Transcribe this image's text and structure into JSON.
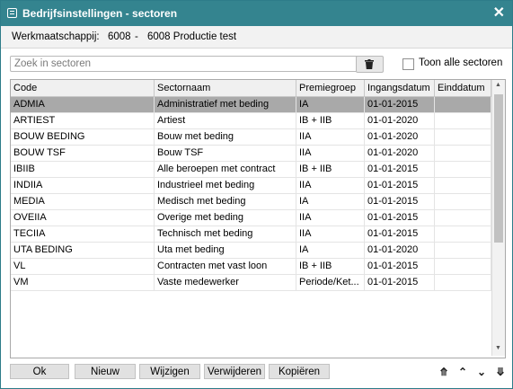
{
  "window": {
    "title": "Bedrijfsinstellingen - sectoren",
    "close_glyph": "✕"
  },
  "company": {
    "label": "Werkmaatschappij:",
    "code": "6008",
    "separator": "-",
    "name": "6008 Productie test"
  },
  "search": {
    "placeholder": "Zoek in sectoren",
    "value": ""
  },
  "show_all": {
    "label": "Toon alle sectoren",
    "checked": false
  },
  "table": {
    "columns": [
      "Code",
      "Sectornaam",
      "Premiegroep",
      "Ingangsdatum",
      "Einddatum"
    ],
    "rows": [
      [
        "ADMIA",
        "Administratief met beding",
        "IA",
        "01-01-2015",
        ""
      ],
      [
        "ARTIEST",
        "Artiest",
        "IB + IIB",
        "01-01-2020",
        ""
      ],
      [
        "BOUW BEDING",
        "Bouw met beding",
        "IIA",
        "01-01-2020",
        ""
      ],
      [
        "BOUW TSF",
        "Bouw TSF",
        "IIA",
        "01-01-2020",
        ""
      ],
      [
        "IBIIB",
        "Alle beroepen met contract",
        "IB + IIB",
        "01-01-2015",
        ""
      ],
      [
        "INDIIA",
        "Industrieel met beding",
        "IIA",
        "01-01-2015",
        ""
      ],
      [
        "MEDIA",
        "Medisch met beding",
        "IA",
        "01-01-2015",
        ""
      ],
      [
        "OVEIIA",
        "Overige met beding",
        "IIA",
        "01-01-2015",
        ""
      ],
      [
        "TECIIA",
        "Technisch met beding",
        "IIA",
        "01-01-2015",
        ""
      ],
      [
        "UTA BEDING",
        "Uta met beding",
        "IA",
        "01-01-2020",
        ""
      ],
      [
        "VL",
        "Contracten met vast loon",
        "IB + IIB",
        "01-01-2015",
        ""
      ],
      [
        "VM",
        "Vaste medewerker",
        "Periode/Ket...",
        "01-01-2015",
        ""
      ]
    ],
    "selected_row": 0
  },
  "buttons": {
    "ok": "Ok",
    "new": "Nieuw",
    "edit": "Wijzigen",
    "delete": "Verwijderen",
    "copy": "Kopiëren"
  },
  "nav": {
    "first": "⤊",
    "up": "⌃",
    "down": "⌄",
    "last": "⤋"
  },
  "colors": {
    "titlebar": "#34848f",
    "selected_row": "#a9a9a9"
  }
}
